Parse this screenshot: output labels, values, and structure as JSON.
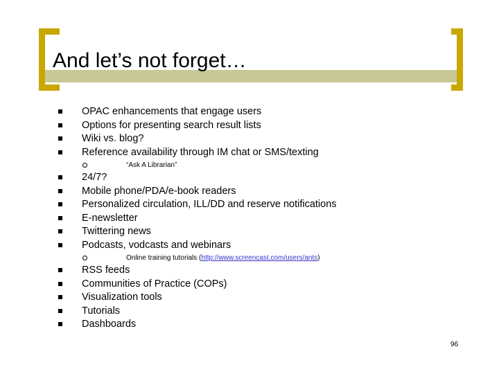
{
  "slide": {
    "title": "And let’s not forget…",
    "page_number": "96",
    "accent_color": "#c8a800",
    "band_color": "#c8c896",
    "link_color": "#3333cc",
    "bullets": [
      {
        "level": 1,
        "text": "OPAC enhancements that engage users"
      },
      {
        "level": 1,
        "text": "Options for presenting search result lists"
      },
      {
        "level": 1,
        "text": "Wiki vs. blog?"
      },
      {
        "level": 1,
        "text": "Reference availability through IM chat or SMS/texting"
      },
      {
        "level": 2,
        "text": "“Ask A Librarian”"
      },
      {
        "level": 1,
        "text": "24/7?"
      },
      {
        "level": 1,
        "text": "Mobile phone/PDA/e-book readers"
      },
      {
        "level": 1,
        "text": "Personalized circulation, ILL/DD and reserve notifications"
      },
      {
        "level": 1,
        "text": "E-newsletter"
      },
      {
        "level": 1,
        "text": "Twittering news"
      },
      {
        "level": 1,
        "text": "Podcasts, vodcasts and webinars"
      },
      {
        "level": 2,
        "text_before": "Online training tutorials (",
        "link_text": "http://www.screencast.com/users/ants",
        "text_after": ")"
      },
      {
        "level": 1,
        "text": "RSS feeds"
      },
      {
        "level": 1,
        "text": "Communities of Practice (COPs)"
      },
      {
        "level": 1,
        "text": "Visualization tools"
      },
      {
        "level": 1,
        "text": "Tutorials"
      },
      {
        "level": 1,
        "text": "Dashboards"
      }
    ]
  }
}
